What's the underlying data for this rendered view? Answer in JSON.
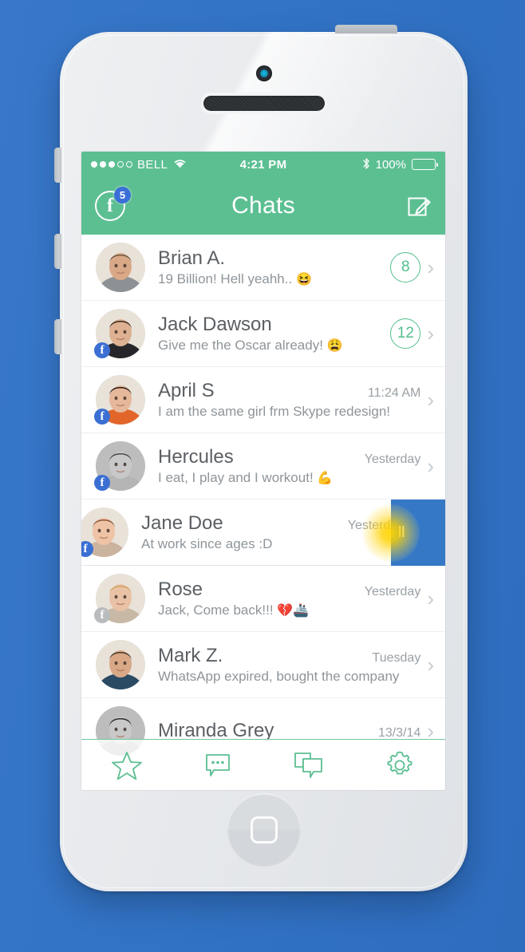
{
  "device": {
    "name": "white-smartphone",
    "camera_icon": "front-camera",
    "home_icon": "home-button-square"
  },
  "status_bar": {
    "signal_filled": 3,
    "signal_total": 5,
    "carrier": "BELL",
    "wifi_icon": "wifi-icon",
    "time": "4:21 PM",
    "bluetooth_icon": "bluetooth-icon",
    "bluetooth_glyph": "ᛗ",
    "battery_percent": "100%",
    "wifi_glyph": "▲"
  },
  "nav_bar": {
    "facebook_label": "f",
    "facebook_badge": "5",
    "title": "Chats",
    "compose_icon": "compose-icon",
    "background_color": "#5cbf92"
  },
  "chats": [
    {
      "name": "Brian A.",
      "preview": "19 Billion! Hell yeahh..",
      "emoji": "😆",
      "time": "",
      "unread": "8",
      "fb_badge": false,
      "fb_badge_muted": false,
      "avatar": "brian-avatar",
      "swiped": false
    },
    {
      "name": "Jack Dawson",
      "preview": "Give me the Oscar already!",
      "emoji": "😩",
      "time": "",
      "unread": "12",
      "fb_badge": true,
      "fb_badge_muted": false,
      "avatar": "jack-avatar",
      "swiped": false
    },
    {
      "name": "April S",
      "preview": "I am the same girl frm Skype redesign!",
      "emoji": "",
      "time": "11:24 AM",
      "unread": "",
      "fb_badge": true,
      "fb_badge_muted": false,
      "avatar": "april-avatar",
      "swiped": false
    },
    {
      "name": "Hercules",
      "preview": "I eat, I play and I workout!",
      "emoji": "💪",
      "time": "Yesterday",
      "unread": "",
      "fb_badge": true,
      "fb_badge_muted": false,
      "avatar": "hercules-avatar",
      "swiped": false
    },
    {
      "name": "Jane Doe",
      "preview": "At work since ages :D",
      "emoji": "",
      "time": "Yesterday",
      "unread": "",
      "fb_badge": true,
      "fb_badge_muted": false,
      "avatar": "jane-avatar",
      "swiped": true
    },
    {
      "name": "Rose",
      "preview": "Jack, Come back!!!",
      "emoji": "💔🚢",
      "time": "Yesterday",
      "unread": "",
      "fb_badge": true,
      "fb_badge_muted": true,
      "avatar": "rose-avatar",
      "swiped": false
    },
    {
      "name": "Mark Z.",
      "preview": "WhatsApp expired, bought the company",
      "emoji": "",
      "time": "Tuesday",
      "unread": "",
      "fb_badge": false,
      "fb_badge_muted": false,
      "avatar": "mark-avatar",
      "swiped": false
    },
    {
      "name": "Miranda Grey",
      "preview": "",
      "emoji": "",
      "time": "13/3/14",
      "unread": "",
      "fb_badge": false,
      "fb_badge_muted": false,
      "avatar": "miranda-avatar",
      "swiped": false
    }
  ],
  "swipe_action": {
    "label": "Call",
    "visible_text": "ll",
    "color": "#3478c6"
  },
  "tab_bar": {
    "items": [
      {
        "name": "tab-favorites",
        "icon": "star-icon"
      },
      {
        "name": "tab-messages",
        "icon": "typing-bubble-icon"
      },
      {
        "name": "tab-chats",
        "icon": "double-chat-bubble-icon"
      },
      {
        "name": "tab-settings",
        "icon": "gear-icon"
      }
    ],
    "accent_color": "#5cbf92"
  },
  "theme": {
    "background": "#3273c5",
    "green": "#5cbf92",
    "blue": "#3478c6"
  }
}
